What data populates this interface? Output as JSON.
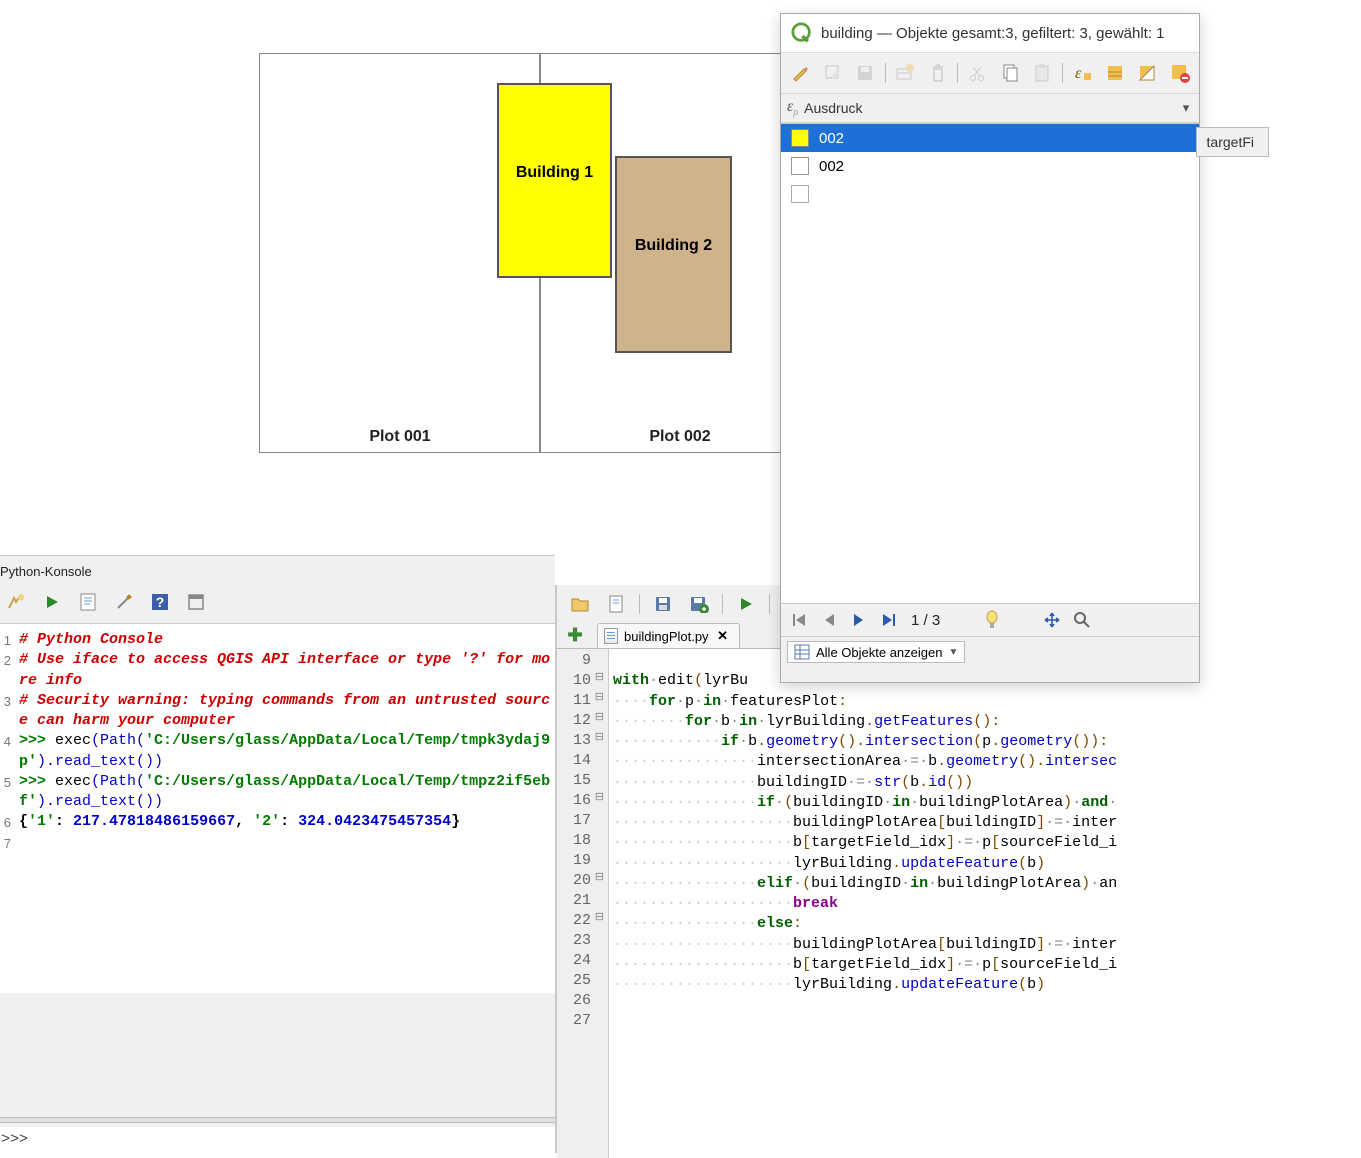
{
  "map": {
    "plot1_label": "Plot 001",
    "plot2_label": "Plot 002",
    "building1_label": "Building 1",
    "building2_label": "Building 2"
  },
  "python_console": {
    "title": "Python-Konsole",
    "prompt": ">>>",
    "lines": {
      "l1": "# Python Console",
      "l2": "# Use iface to access QGIS API interface or type '?' for more info",
      "l3": "# Security warning: typing commands from an untrusted source can harm your computer",
      "l4_prompt": ">>> ",
      "l4a": "exec",
      "l4b": "(Path(",
      "l4c": "'C:/Users/glass/AppData/Local/Temp/tmpk3ydaj9p'",
      "l4d": ").read_text())",
      "l5_prompt": ">>> ",
      "l5a": "exec",
      "l5b": "(Path(",
      "l5c": "'C:/Users/glass/AppData/Local/Temp/tmpz2if5ebf'",
      "l5d": ").read_text())",
      "l6a": "{",
      "l6b": "'1'",
      "l6c": ": ",
      "l6d": "217.47818486159667",
      "l6e": ", ",
      "l6f": "'2'",
      "l6g": ": ",
      "l6h": "324.0423475457354",
      "l6i": "}"
    }
  },
  "editor": {
    "tab_name": "buildingPlot.py",
    "line_start": 9,
    "code": {
      "l10": "with edit(lyrBu",
      "l11": "    for p in featuresPlot:",
      "l12": "        for b in lyrBuilding.getFeatures():",
      "l13": "            if b.geometry().intersection(p.geometry()):",
      "l14": "                intersectionArea = b.geometry().intersec",
      "l15": "                buildingID = str(b.id())",
      "l16": "                if (buildingID in buildingPlotArea) and ",
      "l17": "                    buildingPlotArea[buildingID] = inter",
      "l18": "                    b[targetField_idx] = p[sourceField_i",
      "l19": "                    lyrBuilding.updateFeature(b)",
      "l20": "                elif (buildingID in buildingPlotArea) an",
      "l21": "                    break",
      "l22": "                else:",
      "l23": "                    buildingPlotArea[buildingID] = inter",
      "l24": "                    b[targetField_idx] = p[sourceField_i",
      "l25": "                    lyrBuilding.updateFeature(b)"
    }
  },
  "attr_table": {
    "title": "building — Objekte gesamt:3, gefiltert: 3, gewählt: 1",
    "expression_label": "Ausdruck",
    "field_header": "targetFi",
    "items": [
      {
        "value": "002",
        "selected": true,
        "sym": "b1"
      },
      {
        "value": "002",
        "selected": false,
        "sym": "b2"
      },
      {
        "value": "",
        "selected": false,
        "sym": "empty"
      }
    ],
    "nav_text": "1 / 3",
    "footer_label": "Alle Objekte anzeigen"
  }
}
